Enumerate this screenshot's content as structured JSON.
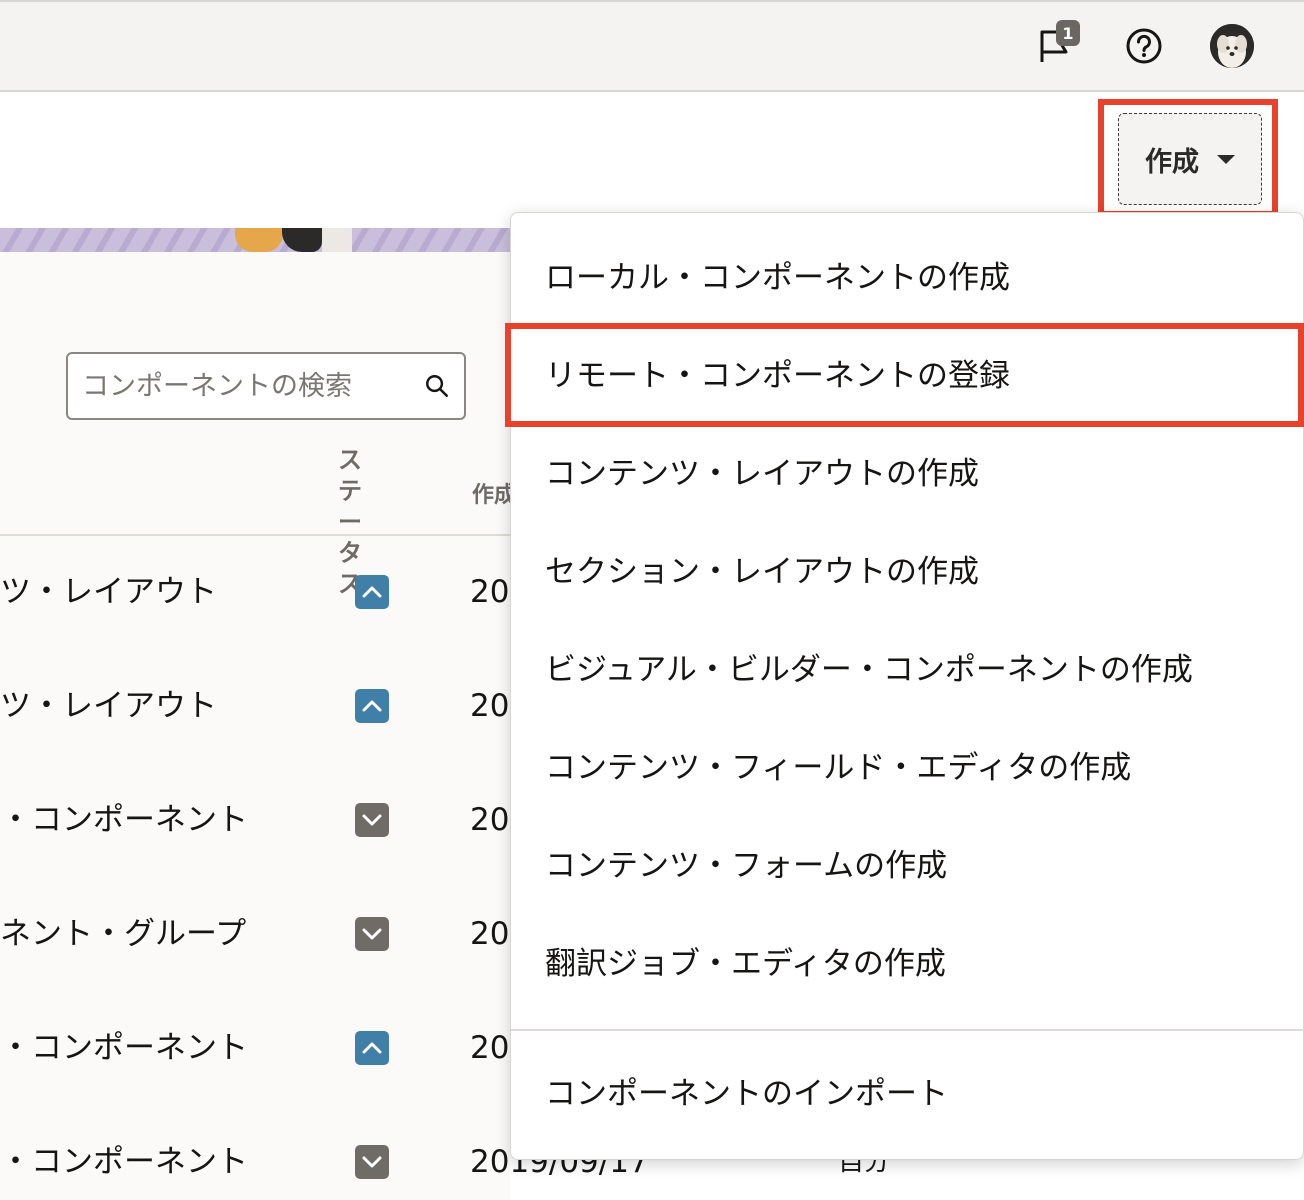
{
  "header": {
    "notifications_badge": "1",
    "create_button_label": "作成"
  },
  "search": {
    "placeholder": "コンポーネントの検索"
  },
  "table": {
    "columns": {
      "status_lines": [
        "ステ",
        "ータ",
        "ス"
      ],
      "created": "作成"
    },
    "rows": [
      {
        "name": "ツ・レイアウト",
        "status": "chevron-up",
        "date": "20"
      },
      {
        "name": "ツ・レイアウト",
        "status": "chevron-up",
        "date": "20"
      },
      {
        "name": "・コンポーネント",
        "status": "chevron-down",
        "date": "20"
      },
      {
        "name": "ネント・グループ",
        "status": "chevron-down",
        "date": "20"
      },
      {
        "name": "・コンポーネント",
        "status": "chevron-up",
        "date": "20"
      },
      {
        "name": "・コンポーネント",
        "status": "chevron-down",
        "date": "2019/09/17",
        "owner": "自分"
      }
    ]
  },
  "create_menu": {
    "items": [
      "ローカル・コンポーネントの作成",
      "リモート・コンポーネントの登録",
      "コンテンツ・レイアウトの作成",
      "セクション・レイアウトの作成",
      "ビジュアル・ビルダー・コンポーネントの作成",
      "コンテンツ・フィールド・エディタの作成",
      "コンテンツ・フォームの作成",
      "翻訳ジョブ・エディタの作成"
    ],
    "footer_item": "コンポーネントのインポート"
  },
  "colors": {
    "highlight": "#e8412c",
    "status_up": "#3f7fa8",
    "status_down": "#6f6c68"
  }
}
